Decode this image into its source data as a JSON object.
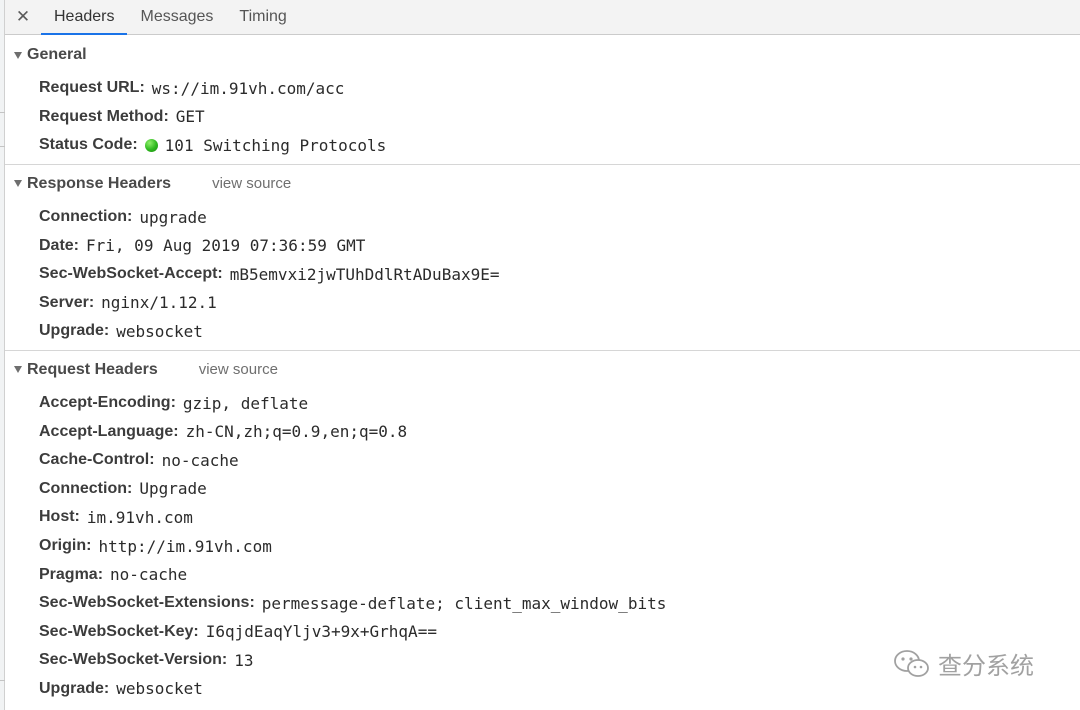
{
  "tabs": {
    "close_icon": "close-icon",
    "items": [
      {
        "label": "Headers",
        "active": true
      },
      {
        "label": "Messages",
        "active": false
      },
      {
        "label": "Timing",
        "active": false
      }
    ]
  },
  "general": {
    "title": "General",
    "request_url": {
      "key": "Request URL:",
      "value": "ws://im.91vh.com/acc"
    },
    "request_method": {
      "key": "Request Method:",
      "value": "GET"
    },
    "status_code": {
      "key": "Status Code:",
      "value": "101 Switching Protocols",
      "dot_color": "#2db81e"
    }
  },
  "response_headers": {
    "title": "Response Headers",
    "view_source": "view source",
    "items": [
      {
        "key": "Connection:",
        "value": "upgrade"
      },
      {
        "key": "Date:",
        "value": "Fri, 09 Aug 2019 07:36:59 GMT"
      },
      {
        "key": "Sec-WebSocket-Accept:",
        "value": "mB5emvxi2jwTUhDdlRtADuBax9E="
      },
      {
        "key": "Server:",
        "value": "nginx/1.12.1"
      },
      {
        "key": "Upgrade:",
        "value": "websocket"
      }
    ]
  },
  "request_headers": {
    "title": "Request Headers",
    "view_source": "view source",
    "items": [
      {
        "key": "Accept-Encoding:",
        "value": "gzip, deflate"
      },
      {
        "key": "Accept-Language:",
        "value": "zh-CN,zh;q=0.9,en;q=0.8"
      },
      {
        "key": "Cache-Control:",
        "value": "no-cache"
      },
      {
        "key": "Connection:",
        "value": "Upgrade"
      },
      {
        "key": "Host:",
        "value": "im.91vh.com"
      },
      {
        "key": "Origin:",
        "value": "http://im.91vh.com"
      },
      {
        "key": "Pragma:",
        "value": "no-cache"
      },
      {
        "key": "Sec-WebSocket-Extensions:",
        "value": "permessage-deflate; client_max_window_bits"
      },
      {
        "key": "Sec-WebSocket-Key:",
        "value": "I6qjdEaqYljv3+9x+GrhqA=="
      },
      {
        "key": "Sec-WebSocket-Version:",
        "value": "13"
      },
      {
        "key": "Upgrade:",
        "value": "websocket"
      }
    ]
  },
  "watermark": {
    "text": "查分系统",
    "icon": "wechat-icon"
  },
  "colors": {
    "active_tab_underline": "#1a73e8",
    "status_dot": "#2db81e"
  }
}
